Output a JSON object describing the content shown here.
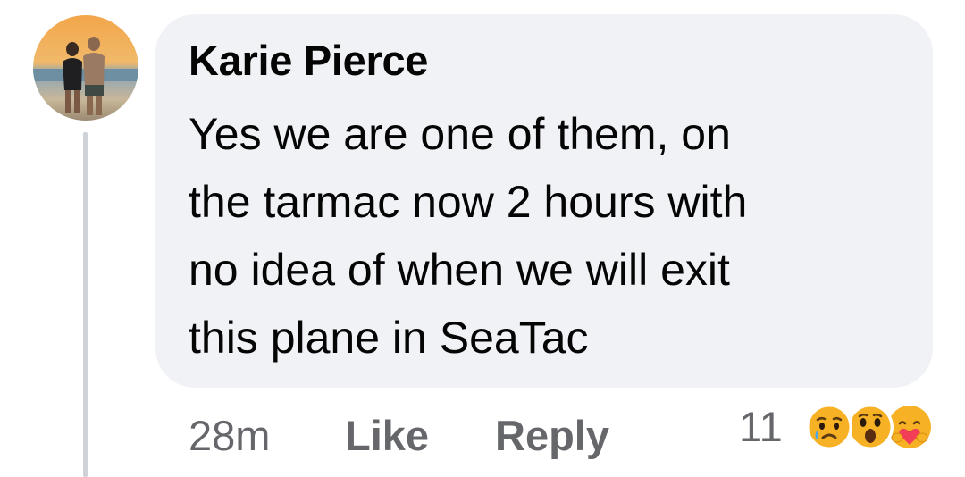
{
  "comment": {
    "author": "Karie Pierce",
    "text_lines": [
      "Yes we are one of them, on",
      "the tarmac now 2 hours with",
      "no idea of when we will exit",
      "this plane in SeaTac"
    ],
    "timestamp": "28m",
    "like_label": "Like",
    "reply_label": "Reply",
    "reaction_count": "11",
    "reactions": [
      "sad-emoji-icon",
      "wow-emoji-icon",
      "care-emoji-icon"
    ]
  },
  "colors": {
    "bubble_bg": "#f0f2f5",
    "text": "#050505",
    "secondary_text": "#65676b",
    "reaction_yellow": "#f7b125"
  }
}
